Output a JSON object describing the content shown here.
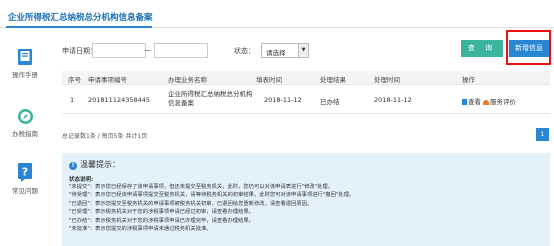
{
  "header": {
    "tab_label": "企业所得税汇总纳税总分机构信息备案"
  },
  "sidebar": {
    "items": [
      {
        "label": "操作手册",
        "icon": "book-icon"
      },
      {
        "label": "办税指南",
        "icon": "compass-icon"
      },
      {
        "label": "常见问题",
        "icon": "question-icon"
      }
    ]
  },
  "search": {
    "date_label": "申请日期：",
    "date_from": "",
    "date_to": "",
    "date_separator": "—",
    "status_label": "状态：",
    "status_value": "请选择",
    "query_button": "查 询",
    "new_button": "新增信息"
  },
  "table": {
    "headers": [
      "序号",
      "申请事项编号",
      "办理业务名称",
      "填表时间",
      "处理结果",
      "处理时间",
      "操作"
    ],
    "rows": [
      {
        "index": "1",
        "app_no": "201811124358445",
        "business_name": "企业所得税汇总纳税总分机构信息备案",
        "fill_time": "2018-11-12",
        "result": "已办结",
        "process_time": "2018-11-12",
        "op_view": "查看",
        "op_rate": "服务评价"
      }
    ]
  },
  "pager": {
    "summary": "总记录数1条 / 每页5条 共计1页",
    "current_page": "1"
  },
  "notice": {
    "title": "温馨提示：",
    "subtitle": "状态说明:",
    "lines": [
      "\"未提交\"：表示您已经保存了该申请事项，但还未提交至税务机关，此时，您仍可以对该申请表进行\"修改\"处理。",
      "\"待受理\"：表示您已经该申请事项提交至税务机关，请等待税务机关的初审结果，此时您可对该申请事项进行\"撤回\"处理。",
      "\"已退回\"：表示您提交至税务机关的申请事项被税务机关初审，已退回给您重新修改，请查看退回原因。",
      "\"已受理\"：表示税务机关对于您的涉税事项申请已经过初审，请查看办理结果。",
      "\"已办结\"：表示税务机关对于您的涉税事项申请已办理完毕，请查看办理结果。",
      "\"未批准\"：表示您提交的涉税事项申请未通过税务机关批准。"
    ]
  },
  "colors": {
    "accent_blue": "#2a86d3",
    "query_green": "#3ab49c",
    "highlight_red": "#e11111",
    "notice_bg": "#e3f1fb"
  }
}
